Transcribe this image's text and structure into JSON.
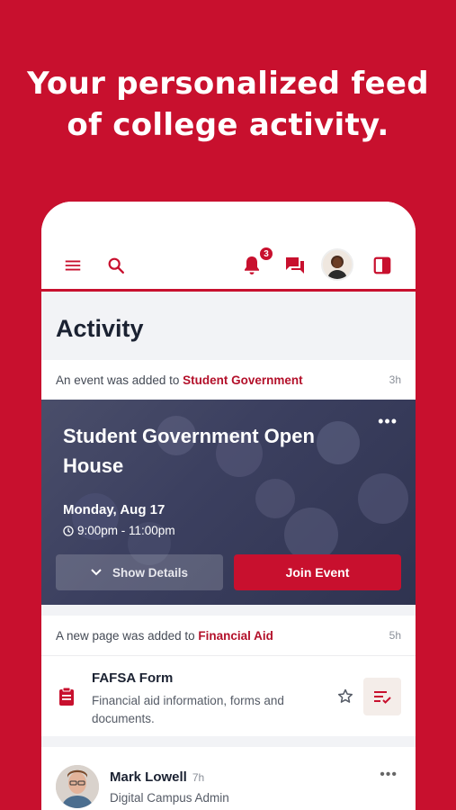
{
  "promo": {
    "headline_line1": "Your personalized feed",
    "headline_line2": "of college activity."
  },
  "appbar": {
    "notification_count": "3",
    "icons": [
      "menu-icon",
      "search-icon",
      "bell-icon",
      "chat-icon",
      "panel-icon"
    ]
  },
  "page": {
    "title": "Activity"
  },
  "event_card": {
    "prefix": "An event was added to ",
    "group": "Student Government",
    "time": "3h",
    "title": "Student Government Open House",
    "date": "Monday, Aug 17",
    "time_range": "9:00pm - 11:00pm",
    "details_label": "Show Details",
    "join_label": "Join Event",
    "more": "•••"
  },
  "page_card": {
    "prefix": "A new page was added to ",
    "group": "Financial Aid",
    "time": "5h",
    "title": "FAFSA Form",
    "description": "Financial aid information, forms and documents."
  },
  "post_card": {
    "name": "Mark Lowell",
    "time": "7h",
    "role": "Digital Campus Admin",
    "more": "•••"
  },
  "colors": {
    "brand": "#C8102E",
    "text_dark": "#1B2232",
    "background": "#F2F3F6"
  }
}
